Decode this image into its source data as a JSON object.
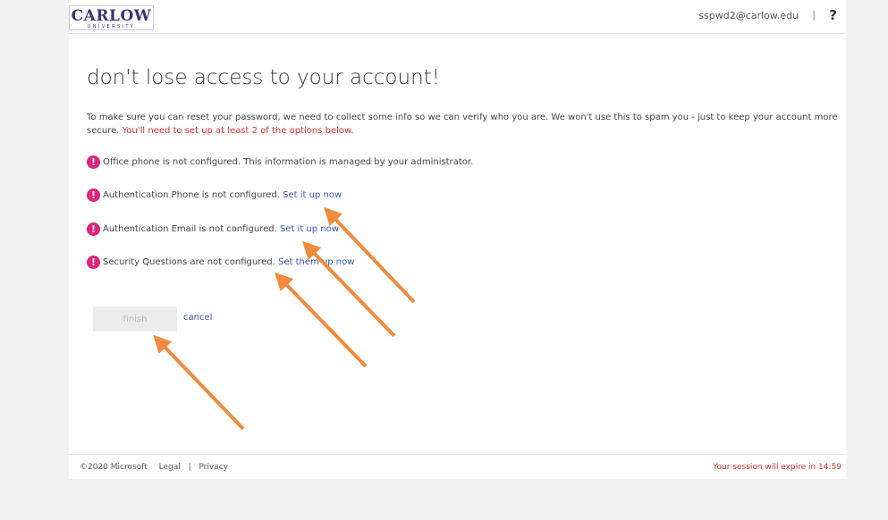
{
  "header": {
    "logo_main": "CARLOW",
    "logo_sub": "UNIVERSITY",
    "user_email": "sspwd2@carlow.edu",
    "separator": "|",
    "help_label": "?"
  },
  "main": {
    "title": "don't lose access to your account!",
    "intro_text": "To make sure you can reset your password, we need to collect some info so we can verify who you are. We won't use this to spam you - just to keep your account more secure.",
    "intro_warning": "You'll need to set up at least 2 of the options below.",
    "options": [
      {
        "text": "Office phone is not configured. This information is managed by your administrator.",
        "link": ""
      },
      {
        "text": "Authentication Phone is not configured.",
        "link": "Set it up now"
      },
      {
        "text": "Authentication Email is not configured.",
        "link": "Set it up now"
      },
      {
        "text": "Security Questions are not configured.",
        "link": "Set them up now"
      }
    ],
    "alert_glyph": "!",
    "finish_label": "finish",
    "cancel_label": "cancel"
  },
  "footer": {
    "copyright": "©2020 Microsoft",
    "legal": "Legal",
    "separator": "|",
    "privacy": "Privacy",
    "session_text": "Your session will expire in 14:59"
  },
  "colors": {
    "accent_link": "#3456b8",
    "alert_icon": "#e0247c",
    "warning_text": "#d9302c",
    "arrow_annotation": "#f08a3c",
    "logo_brand": "#3a3275"
  }
}
